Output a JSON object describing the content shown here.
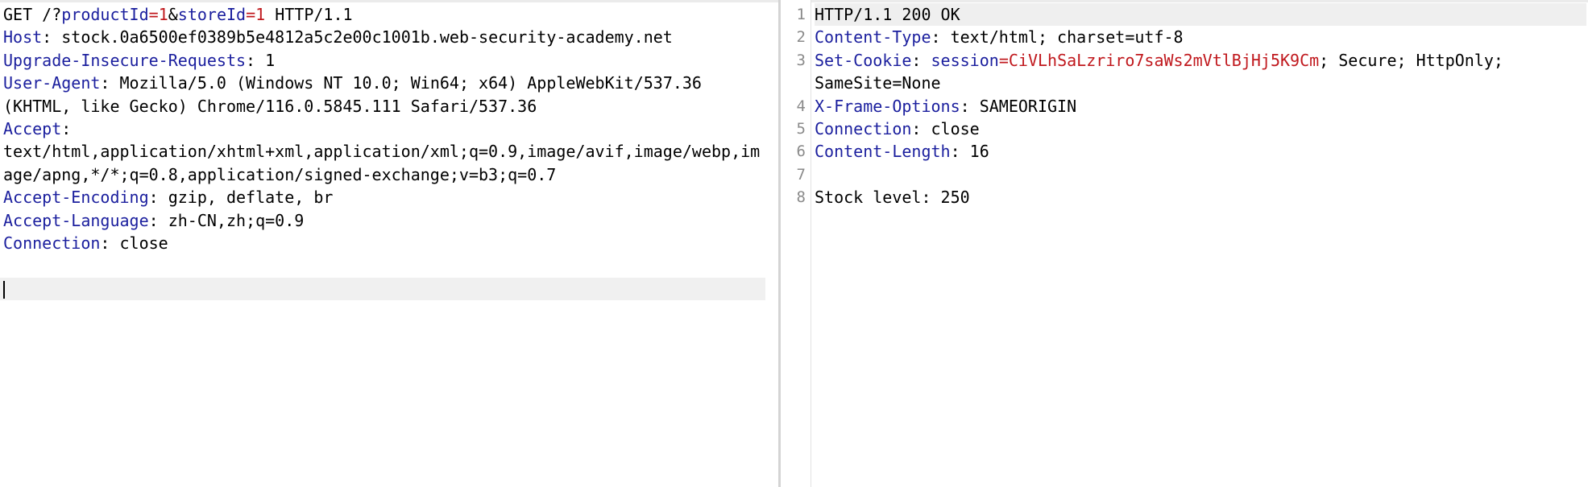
{
  "request": {
    "request_line": {
      "method": "GET",
      "path_start": "/?",
      "params": [
        {
          "name": "productId",
          "eq": "=",
          "value": "1"
        },
        {
          "sep": "&",
          "name": "storeId",
          "eq": "=",
          "value": "1"
        }
      ],
      "version": " HTTP/1.1"
    },
    "headers": [
      {
        "name": "Host",
        "sep": ": ",
        "value": "stock.0a6500ef0389b5e4812a5c2e00c1001b.web-security-academy.net"
      },
      {
        "name": "Upgrade-Insecure-Requests",
        "sep": ": ",
        "value": "1"
      },
      {
        "name": "User-Agent",
        "sep": ": ",
        "value": "Mozilla/5.0 (Windows NT 10.0; Win64; x64) AppleWebKit/537.36",
        "continuation": "(KHTML, like Gecko) Chrome/116.0.5845.111 Safari/537.36"
      },
      {
        "name": "Accept",
        "sep": ":",
        "value": "",
        "continuation": "text/html,application/xhtml+xml,application/xml;q=0.9,image/avif,image/webp,im",
        "continuation2": "age/apng,*/*;q=0.8,application/signed-exchange;v=b3;q=0.7"
      },
      {
        "name": "Accept-Encoding",
        "sep": ": ",
        "value": "gzip, deflate, br"
      },
      {
        "name": "Accept-Language",
        "sep": ": ",
        "value": "zh-CN,zh;q=0.9"
      },
      {
        "name": "Connection",
        "sep": ": ",
        "value": "close"
      }
    ]
  },
  "response": {
    "line_numbers": [
      "1",
      "2",
      "3",
      "4",
      "5",
      "6",
      "7",
      "8"
    ],
    "status_line": "HTTP/1.1 200 OK",
    "content_type": {
      "name": "Content-Type",
      "sep": ": ",
      "value": "text/html; charset=utf-8"
    },
    "set_cookie": {
      "name": "Set-Cookie",
      "sep": ": ",
      "cookie_name": "session",
      "eq": "=",
      "cookie_value": "CiVLhSaLzriro7saWs2mVtlBjHj5K9Cm",
      "attrs": "; Secure; HttpOnly; SameSite=None"
    },
    "frame_options": {
      "name": "X-Frame-Options",
      "sep": ": ",
      "value": "SAMEORIGIN"
    },
    "connection": {
      "name": "Connection",
      "sep": ": ",
      "value": "close"
    },
    "content_length": {
      "name": "Content-Length",
      "sep": ": ",
      "value": "16"
    },
    "body": "Stock level: 250"
  },
  "colors": {
    "header_name": "#1b1f9e",
    "param_value": "#c0181d",
    "caret_line_bg": "#f0f0f0"
  }
}
